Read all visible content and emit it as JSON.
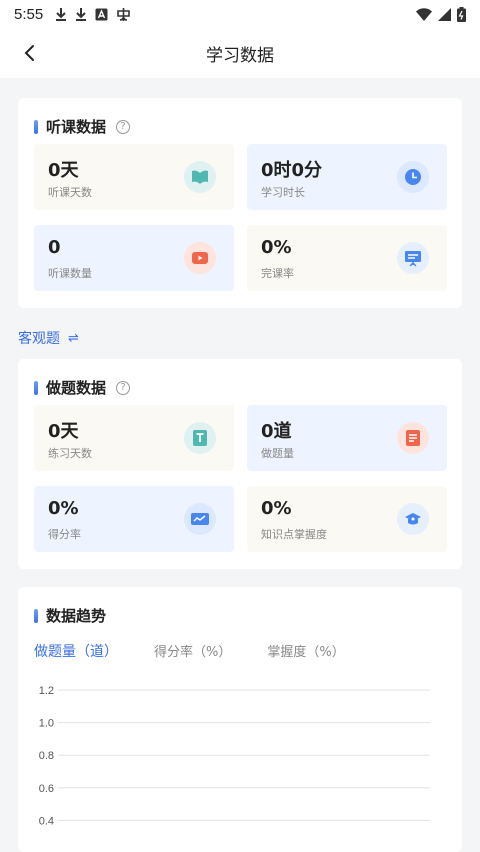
{
  "status": {
    "time": "5:55"
  },
  "header": {
    "title": "学习数据"
  },
  "listen": {
    "title": "听课数据",
    "stats": [
      {
        "value": "0天",
        "label": "听课天数"
      },
      {
        "value": "0时0分",
        "label": "学习时长"
      },
      {
        "value": "0",
        "label": "听课数量"
      },
      {
        "value": "0%",
        "label": "完课率"
      }
    ]
  },
  "switch": {
    "label": "客观题",
    "icon": "⇌"
  },
  "practice": {
    "title": "做题数据",
    "stats": [
      {
        "value": "0天",
        "label": "练习天数"
      },
      {
        "value": "0道",
        "label": "做题量"
      },
      {
        "value": "0%",
        "label": "得分率"
      },
      {
        "value": "0%",
        "label": "知识点掌握度"
      }
    ]
  },
  "trend": {
    "title": "数据趋势",
    "tabs": [
      "做题量（道）",
      "得分率（%）",
      "掌握度（%）"
    ]
  },
  "colors": {
    "accent": "#3a6fe0",
    "beige_card": "#fbf9f4",
    "blue_card": "#eef4ff"
  },
  "chart_data": {
    "type": "line",
    "y_ticks": [
      "1.2",
      "1.0",
      "0.8",
      "0.6",
      "0.4"
    ],
    "ylim": [
      0.4,
      1.2
    ],
    "series": [],
    "grid": true
  }
}
